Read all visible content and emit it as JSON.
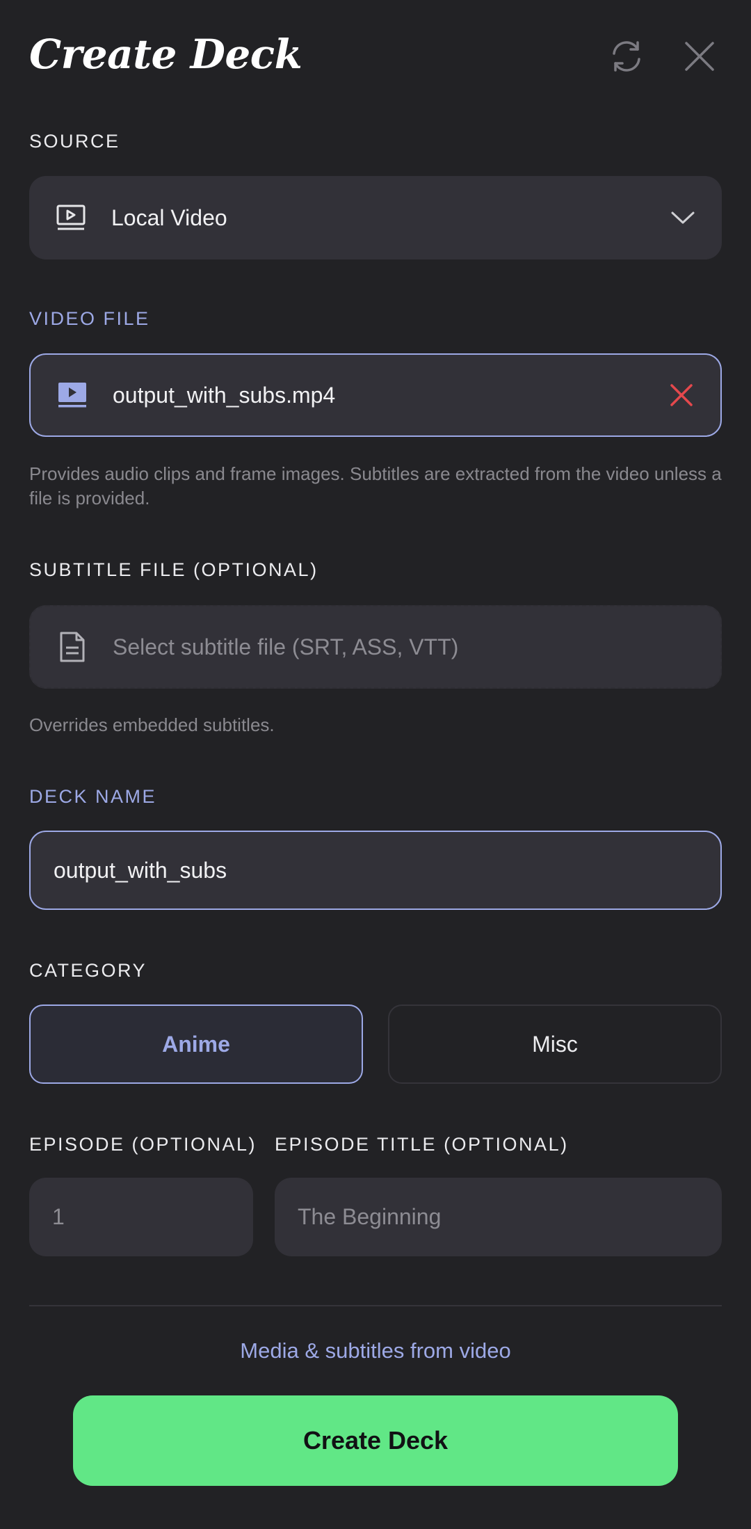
{
  "header": {
    "title": "Create Deck",
    "refresh_icon": "refresh-icon",
    "close_icon": "close-icon"
  },
  "source": {
    "label": "SOURCE",
    "icon": "video-player-icon",
    "value": "Local Video",
    "dropdown_icon": "chevron-down-icon"
  },
  "video_file": {
    "label": "VIDEO FILE",
    "icon": "video-file-icon",
    "value": "output_with_subs.mp4",
    "clear_icon": "clear-icon",
    "helper": "Provides audio clips and frame images. Subtitles are extracted from the video unless a file is provided."
  },
  "subtitle_file": {
    "label": "SUBTITLE FILE (OPTIONAL)",
    "icon": "document-icon",
    "placeholder": "Select subtitle file (SRT, ASS, VTT)",
    "helper": "Overrides embedded subtitles."
  },
  "deck_name": {
    "label": "DECK NAME",
    "value": "output_with_subs"
  },
  "category": {
    "label": "CATEGORY",
    "options": [
      "Anime",
      "Misc"
    ],
    "selected": "Anime"
  },
  "episode": {
    "label": "EPISODE (OPTIONAL)",
    "placeholder": "1"
  },
  "episode_title": {
    "label": "EPISODE TITLE (OPTIONAL)",
    "placeholder": "The Beginning"
  },
  "footer": {
    "note": "Media & subtitles from video",
    "create_label": "Create Deck"
  },
  "colors": {
    "background": "#222225",
    "field": "#323138",
    "accent": "#9da9e6",
    "primary": "#61e786",
    "danger": "#e5484d",
    "muted": "#8a898f"
  }
}
